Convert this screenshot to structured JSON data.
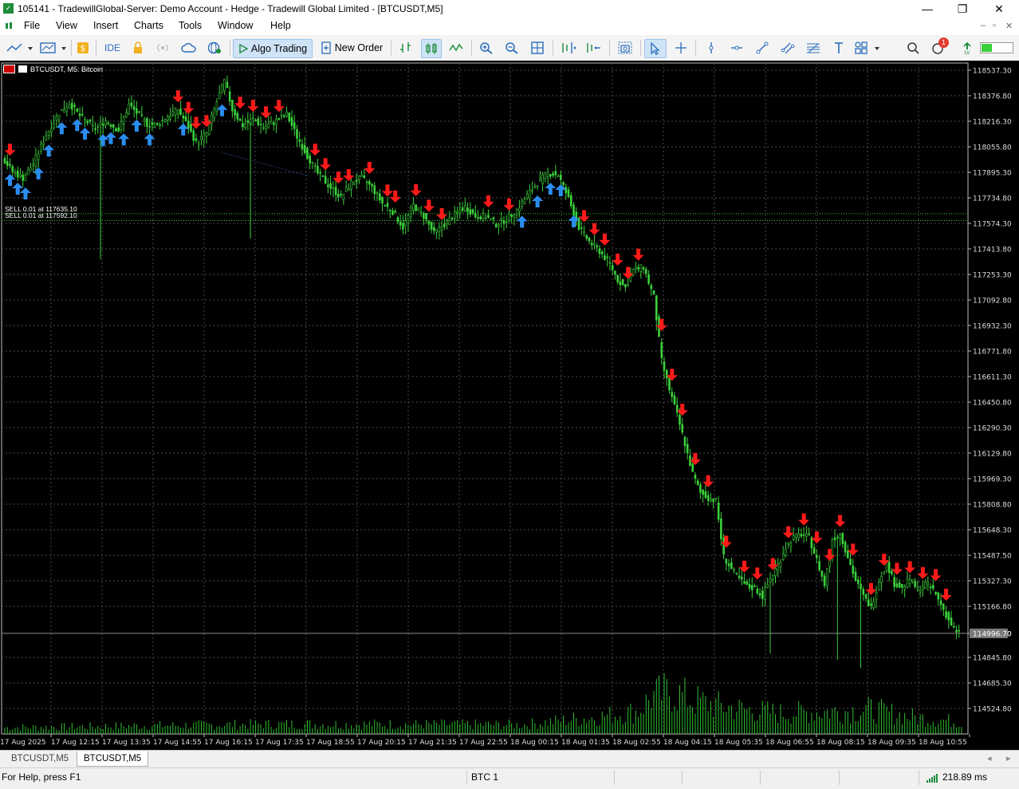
{
  "window": {
    "title": "105141 - TradewillGlobal-Server: Demo Account - Hedge - Tradewill Global Limited - [BTCUSDT,M5]",
    "minimize": "—",
    "restore": "❐",
    "close": "✕"
  },
  "menu": {
    "items": [
      "File",
      "View",
      "Insert",
      "Charts",
      "Tools",
      "Window",
      "Help"
    ],
    "mdi_minimize": "–",
    "mdi_restore": "▫",
    "mdi_close": "✕"
  },
  "toolbar": {
    "ide_label": "IDE",
    "algo_trading_label": "Algo Trading",
    "new_order_label": "New Order",
    "notification_count": "1"
  },
  "chart": {
    "title": "BTCUSDT, M5:  Bitcoin",
    "current_price": "114996.70",
    "colors": {
      "background": "#000000",
      "candle": "#3bd13b",
      "volume": "#2fbf2f",
      "grid": "#4a4a4a",
      "buy_arrow": "#2b8df0",
      "sell_arrow": "#ff1a1a",
      "price_line": "#8a8a8a"
    },
    "orders": [
      {
        "label": "SELL 0.01 at 117635.10",
        "price": 117635.1
      },
      {
        "label": "SELL 0.01 at 117592.10",
        "price": 117592.1
      }
    ]
  },
  "chart_data": {
    "type": "candlestick",
    "symbol": "BTCUSDT",
    "timeframe": "M5",
    "y_axis_ticks": [
      "118537.30",
      "118376.80",
      "118216.30",
      "118055.80",
      "117895.30",
      "117734.80",
      "117574.30",
      "117413.80",
      "117253.30",
      "117092.80",
      "116932.30",
      "116771.80",
      "116611.30",
      "116450.80",
      "116290.30",
      "116129.80",
      "115969.30",
      "115808.80",
      "115648.30",
      "115487.50",
      "115327.30",
      "115166.80",
      "114996.70",
      "114845.80",
      "114685.30",
      "114524.80"
    ],
    "x_axis_ticks": [
      "17 Aug 2025",
      "17 Aug 12:15",
      "17 Aug 13:35",
      "17 Aug 14:55",
      "17 Aug 16:15",
      "17 Aug 17:35",
      "17 Aug 18:55",
      "17 Aug 20:15",
      "17 Aug 21:35",
      "17 Aug 22:55",
      "18 Aug 00:15",
      "18 Aug 01:35",
      "18 Aug 02:55",
      "18 Aug 04:15",
      "18 Aug 05:35",
      "18 Aug 06:55",
      "18 Aug 08:15",
      "18 Aug 09:35",
      "18 Aug 10:55"
    ],
    "price_path": [
      [
        0,
        117990
      ],
      [
        4,
        117900
      ],
      [
        8,
        117860
      ],
      [
        12,
        117950
      ],
      [
        17,
        118130
      ],
      [
        22,
        118270
      ],
      [
        26,
        118330
      ],
      [
        30,
        118250
      ],
      [
        36,
        118170
      ],
      [
        40,
        118220
      ],
      [
        45,
        118160
      ],
      [
        49,
        118320
      ],
      [
        52,
        118270
      ],
      [
        56,
        118200
      ],
      [
        60,
        118190
      ],
      [
        64,
        118250
      ],
      [
        68,
        118290
      ],
      [
        72,
        118180
      ],
      [
        75,
        118080
      ],
      [
        79,
        118140
      ],
      [
        83,
        118340
      ],
      [
        86,
        118470
      ],
      [
        89,
        118290
      ],
      [
        93,
        118190
      ],
      [
        97,
        118230
      ],
      [
        101,
        118180
      ],
      [
        105,
        118210
      ],
      [
        110,
        118260
      ],
      [
        114,
        118120
      ],
      [
        118,
        118000
      ],
      [
        122,
        117890
      ],
      [
        127,
        117800
      ],
      [
        131,
        117740
      ],
      [
        135,
        117830
      ],
      [
        139,
        117860
      ],
      [
        143,
        117800
      ],
      [
        147,
        117700
      ],
      [
        151,
        117650
      ],
      [
        155,
        117550
      ],
      [
        159,
        117690
      ],
      [
        163,
        117620
      ],
      [
        167,
        117510
      ],
      [
        171,
        117570
      ],
      [
        175,
        117630
      ],
      [
        179,
        117680
      ],
      [
        183,
        117620
      ],
      [
        187,
        117620
      ],
      [
        191,
        117570
      ],
      [
        195,
        117600
      ],
      [
        199,
        117660
      ],
      [
        203,
        117750
      ],
      [
        207,
        117830
      ],
      [
        211,
        117890
      ],
      [
        215,
        117880
      ],
      [
        219,
        117730
      ],
      [
        223,
        117550
      ],
      [
        227,
        117460
      ],
      [
        231,
        117400
      ],
      [
        235,
        117320
      ],
      [
        238,
        117220
      ],
      [
        241,
        117170
      ],
      [
        244,
        117280
      ],
      [
        248,
        117300
      ],
      [
        252,
        117110
      ],
      [
        255,
        116710
      ],
      [
        258,
        116530
      ],
      [
        261,
        116370
      ],
      [
        264,
        116190
      ],
      [
        267,
        116000
      ],
      [
        270,
        115880
      ],
      [
        273,
        115850
      ],
      [
        276,
        115830
      ],
      [
        279,
        115480
      ],
      [
        282,
        115400
      ],
      [
        285,
        115340
      ],
      [
        288,
        115290
      ],
      [
        291,
        115280
      ],
      [
        294,
        115230
      ],
      [
        297,
        115340
      ],
      [
        300,
        115430
      ],
      [
        303,
        115540
      ],
      [
        306,
        115600
      ],
      [
        309,
        115620
      ],
      [
        312,
        115600
      ],
      [
        315,
        115460
      ],
      [
        318,
        115300
      ],
      [
        321,
        115590
      ],
      [
        324,
        115620
      ],
      [
        327,
        115480
      ],
      [
        330,
        115330
      ],
      [
        333,
        115230
      ],
      [
        336,
        115160
      ],
      [
        339,
        115330
      ],
      [
        342,
        115440
      ],
      [
        345,
        115310
      ],
      [
        348,
        115280
      ],
      [
        351,
        115340
      ],
      [
        354,
        115270
      ],
      [
        357,
        115310
      ],
      [
        360,
        115270
      ],
      [
        363,
        115180
      ],
      [
        366,
        115080
      ],
      [
        369,
        114996.7
      ]
    ],
    "path_index_range": [
      0,
      370
    ],
    "volume_profile": [
      [
        0,
        0.12
      ],
      [
        50,
        0.15
      ],
      [
        100,
        0.18
      ],
      [
        150,
        0.18
      ],
      [
        200,
        0.17
      ],
      [
        230,
        0.32
      ],
      [
        245,
        0.42
      ],
      [
        250,
        0.68
      ],
      [
        258,
        0.78
      ],
      [
        266,
        0.62
      ],
      [
        276,
        0.52
      ],
      [
        286,
        0.45
      ],
      [
        300,
        0.38
      ],
      [
        320,
        0.42
      ],
      [
        335,
        0.45
      ],
      [
        350,
        0.32
      ],
      [
        370,
        0.22
      ]
    ],
    "buy_signals": [
      2,
      5,
      8,
      13,
      17,
      22,
      28,
      31,
      38,
      41,
      46,
      51,
      56,
      69,
      84,
      200,
      206,
      211,
      215,
      220
    ],
    "sell_signals": [
      2,
      67,
      71,
      74,
      78,
      91,
      96,
      101,
      106,
      120,
      124,
      129,
      133,
      141,
      148,
      151,
      159,
      164,
      169,
      187,
      195,
      224,
      228,
      232,
      237,
      241,
      245,
      254,
      258,
      262,
      267,
      272,
      279,
      286,
      291,
      297,
      303,
      309,
      314,
      319,
      323,
      328,
      335,
      340,
      345,
      350,
      355,
      360,
      364
    ]
  },
  "tabs": {
    "items": [
      "BTCUSDT,M5",
      "BTCUSDT,M5"
    ],
    "scroll_left": "◂",
    "scroll_right": "▸"
  },
  "status": {
    "help_text": "For Help, press F1",
    "profile": "BTC 1",
    "ping": "218.89 ms"
  }
}
